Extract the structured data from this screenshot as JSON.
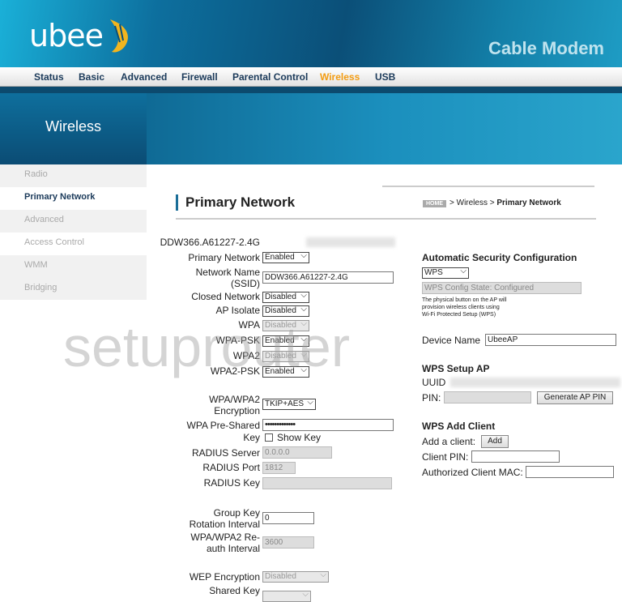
{
  "header": {
    "logo": "ubee",
    "product": "Cable Modem"
  },
  "nav": [
    {
      "label": "Status"
    },
    {
      "label": "Basic"
    },
    {
      "label": "Advanced"
    },
    {
      "label": "Firewall"
    },
    {
      "label": "Parental Control"
    },
    {
      "label": "Wireless",
      "active": true
    },
    {
      "label": "USB"
    }
  ],
  "section": "Wireless",
  "sidebar": [
    {
      "label": "Radio"
    },
    {
      "label": "Primary Network",
      "active": true
    },
    {
      "label": "Advanced"
    },
    {
      "label": "Access Control"
    },
    {
      "label": "WMM"
    },
    {
      "label": "Bridging"
    }
  ],
  "page": {
    "title": "Primary Network",
    "breadcrumb": {
      "home": "HOME",
      "sep": ">",
      "parent": "Wireless",
      "current": "Primary Network"
    }
  },
  "form": {
    "ssid_heading": "DDW366.A61227-2.4G",
    "primary_network": {
      "label": "Primary Network",
      "value": "Enabled"
    },
    "ssid": {
      "label1": "Network Name",
      "label2": "(SSID)",
      "value": "DDW366.A61227-2.4G"
    },
    "closed_network": {
      "label": "Closed Network",
      "value": "Disabled"
    },
    "ap_isolate": {
      "label": "AP Isolate",
      "value": "Disabled"
    },
    "wpa": {
      "label": "WPA",
      "value": "Disabled"
    },
    "wpa_psk": {
      "label": "WPA-PSK",
      "value": "Enabled"
    },
    "wpa2": {
      "label": "WPA2",
      "value": "Disabled"
    },
    "wpa2_psk": {
      "label": "WPA2-PSK",
      "value": "Enabled"
    },
    "encryption": {
      "label1": "WPA/WPA2",
      "label2": "Encryption",
      "value": "TKIP+AES"
    },
    "psk": {
      "label1": "WPA Pre-Shared",
      "label2": "Key",
      "value": "•••••••••••••",
      "show_key": "Show Key"
    },
    "radius_server": {
      "label": "RADIUS Server",
      "value": "0.0.0.0"
    },
    "radius_port": {
      "label": "RADIUS Port",
      "value": "1812"
    },
    "radius_key": {
      "label": "RADIUS Key",
      "value": ""
    },
    "group_key": {
      "label1": "Group Key",
      "label2": "Rotation Interval",
      "value": "0"
    },
    "reauth": {
      "label1": "WPA/WPA2 Re-",
      "label2": "auth Interval",
      "value": "3600"
    },
    "wep": {
      "label": "WEP Encryption",
      "value": "Disabled"
    },
    "shared_key": {
      "label": "Shared Key"
    }
  },
  "wps": {
    "heading": "Automatic Security Configuration",
    "mode": "WPS",
    "state": "WPS Config State: Configured",
    "note1": "The physical button on the AP will",
    "note2": "provision wireless clients using",
    "note3": "Wi-Fi Protected Setup (WPS)",
    "device_name_label": "Device Name",
    "device_name": "UbeeAP",
    "setup_heading": "WPS Setup AP",
    "uuid_label": "UUID",
    "pin_label": "PIN:",
    "generate_label": "Generate AP PIN",
    "add_heading": "WPS Add Client",
    "add_client_label": "Add a client:",
    "add_button": "Add",
    "client_pin_label": "Client PIN:",
    "client_mac_label": "Authorized Client MAC:"
  },
  "watermark": "setuprouter",
  "colors": {
    "accent": "#f39c12",
    "nav_text": "#1b3a5a",
    "header": "#0b4f78"
  }
}
